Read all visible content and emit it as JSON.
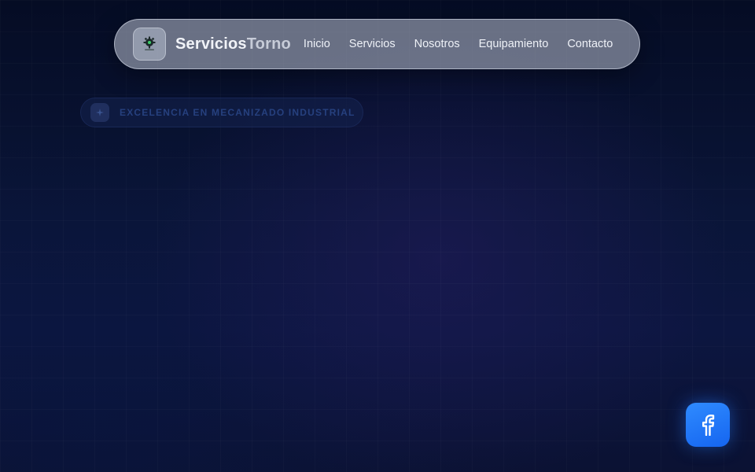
{
  "brand": {
    "name_part1": "Servicios",
    "name_part2": "Torno",
    "logo_icon": "gear-logo-icon"
  },
  "nav": {
    "items": [
      {
        "label": "Inicio"
      },
      {
        "label": "Servicios"
      },
      {
        "label": "Nosotros"
      },
      {
        "label": "Equipamiento"
      },
      {
        "label": "Contacto"
      }
    ]
  },
  "hero": {
    "badge_text": "EXCELENCIA EN MECANIZADO INDUSTRIAL",
    "badge_icon": "sparkle-icon"
  },
  "floating": {
    "facebook_icon": "facebook-icon",
    "accent_color": "#1f7bff"
  },
  "colors": {
    "background": "#0a1538",
    "navbar": "#b2b8c8",
    "badge_text": "#26407e"
  }
}
